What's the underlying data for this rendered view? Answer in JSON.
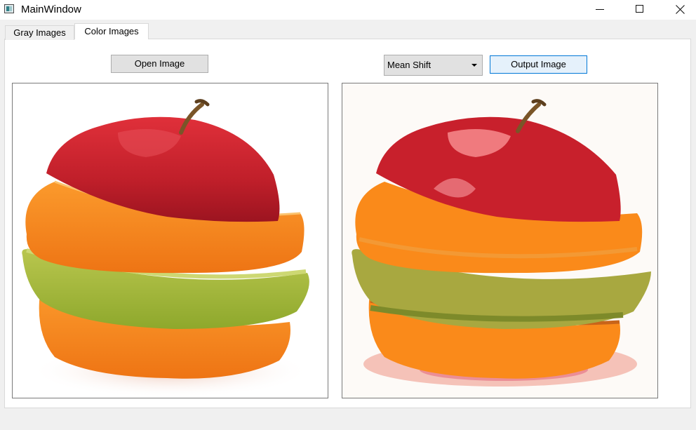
{
  "window": {
    "title": "MainWindow"
  },
  "tabs": [
    {
      "label": "Gray Images",
      "selected": false
    },
    {
      "label": "Color Images",
      "selected": true
    }
  ],
  "toolbar": {
    "open_label": "Open Image",
    "method_selected": "Mean Shift",
    "output_label": "Output Image"
  },
  "images": {
    "input": {
      "subject": "layered apple and orange slices on white background"
    },
    "output": {
      "subject": "mean shift segmented apple and orange slices"
    }
  },
  "colors": {
    "apple_red": "#c8202c",
    "orange": "#f58220",
    "green_apple": "#a5b83a",
    "output_orange": "#fa8a1a",
    "output_green": "#a8a840",
    "accent_button_border": "#0078d7"
  },
  "icons": [
    "app-icon",
    "minimize-icon",
    "maximize-icon",
    "close-icon",
    "dropdown-arrow-icon"
  ]
}
